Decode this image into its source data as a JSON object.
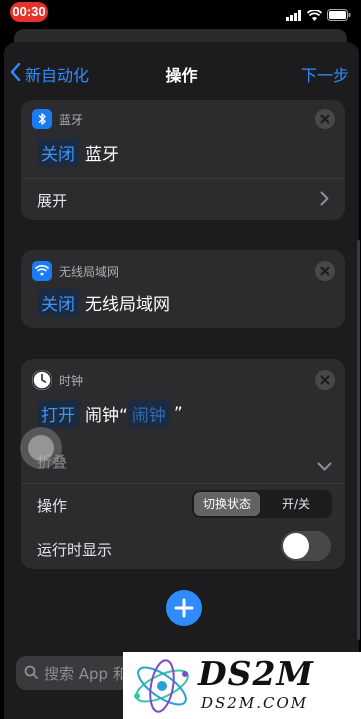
{
  "status_bar": {
    "time": "00:30"
  },
  "nav": {
    "back_label": "新自动化",
    "title": "操作",
    "next_label": "下一步"
  },
  "cards": {
    "bluetooth": {
      "app_label": "蓝牙",
      "action": "关闭",
      "target": "蓝牙",
      "expand_label": "展开"
    },
    "wifi": {
      "app_label": "无线局域网",
      "action": "关闭",
      "target": "无线局域网"
    },
    "clock": {
      "app_label": "时钟",
      "action": "打开",
      "text_before": "闹钟“",
      "param": "闹钟",
      "text_after": "”",
      "collapse_label": "折叠",
      "operation_label": "操作",
      "operation_options": [
        "切换状态",
        "开/关"
      ],
      "operation_selected": "切换状态",
      "show_when_run_label": "运行时显示",
      "show_when_run": false
    }
  },
  "search": {
    "placeholder": "搜索 App 和"
  },
  "watermark": {
    "title": "DS2M",
    "subtitle": "DS2M.COM"
  },
  "colors": {
    "accent": "#2f8cff",
    "bluetooth_icon": "#1a7cf5",
    "wifi_icon": "#1a7cf5",
    "time_pill": "#e5322b"
  }
}
